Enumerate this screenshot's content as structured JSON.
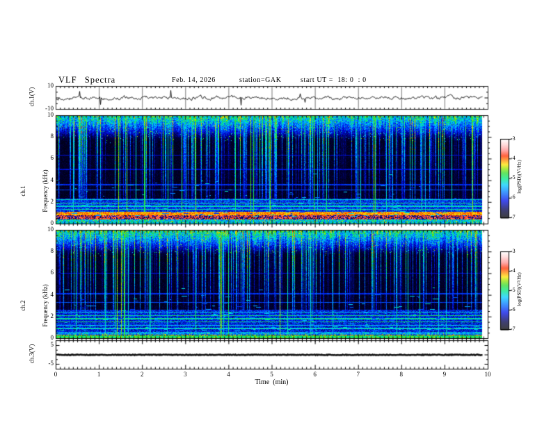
{
  "header": {
    "title": "VLF Spectra",
    "date": "Feb. 14, 2026",
    "station": "station=GAK",
    "start_ut": "start UT =  18: 0  : 0"
  },
  "axes": {
    "x": {
      "label": "Time  (min)",
      "min": 0,
      "max": 10,
      "tick_labels": [
        "0",
        "1",
        "2",
        "3",
        "4",
        "5",
        "6",
        "7",
        "8",
        "9",
        "10"
      ]
    }
  },
  "panels": {
    "ch1_wave": {
      "ylabel": "ch.1(V)",
      "yrange": [
        -10,
        10
      ],
      "tick_labels": [
        "10",
        "-10"
      ]
    },
    "spec1": {
      "ylabel_line1": "ch.1",
      "ylabel_line2": "Frequency (kHz)",
      "tick_labels": [
        "10",
        "8",
        "6",
        "4",
        "2",
        "0"
      ]
    },
    "spec2": {
      "ylabel_line1": "ch.2",
      "ylabel_line2": "Frequency (kHz)",
      "tick_labels": [
        "10",
        "8",
        "6",
        "4",
        "2",
        "0"
      ]
    },
    "ch3_wave": {
      "ylabel": "ch.3(V)",
      "yrange": [
        -5,
        5
      ],
      "tick_labels": [
        "5",
        "-5"
      ]
    }
  },
  "colorbar": {
    "label": "log(PSD)(V²/Hz)",
    "tick_labels": [
      "-3",
      "-4",
      "-5",
      "-6",
      "-7"
    ],
    "range": [
      -7,
      -3
    ]
  },
  "chart_data": {
    "type": "heatmap",
    "title": "VLF Spectra",
    "subtitle": "Feb. 14, 2026  station=GAK  start UT = 18:0:0",
    "x": {
      "label": "Time (min)",
      "range": [
        0,
        10
      ],
      "major_tick_min": 1,
      "minor_tick_min": 0.1
    },
    "panels": [
      {
        "id": "ch1-waveform",
        "type": "line",
        "ylabel": "ch.1(V)",
        "yrange": [
          -10,
          10
        ],
        "yticks": [
          10,
          -10
        ],
        "description": "broadband noise centered near 0 V, typical excursions ±2 V, impulsive spikes to about ±7 V"
      },
      {
        "id": "ch1-spectrogram",
        "type": "heatmap",
        "ylabel": "ch.1 Frequency (kHz)",
        "yrange": [
          0,
          10
        ],
        "yticks": [
          0,
          2,
          4,
          6,
          8,
          10
        ],
        "z_label": "log(PSD)(V²/Hz)",
        "z_range": [
          -7,
          -3
        ],
        "features": {
          "sferic_streak_density": 0.5,
          "line_emissions": [
            {
              "f": 1.05,
              "psd": -5.3
            },
            {
              "f": 1.3,
              "psd": -5.1
            },
            {
              "f": 1.6,
              "psd": -5.2
            },
            {
              "f": 1.9,
              "psd": -5.0
            },
            {
              "f": 2.2,
              "psd": -5.2
            },
            {
              "f": 3.1,
              "psd": -5.9
            },
            {
              "f": 3.6,
              "psd": -6.0
            },
            {
              "f": 5.0,
              "psd": -6.2
            },
            {
              "f": 6.3,
              "psd": -6.2
            }
          ],
          "bands": [
            {
              "f_khz": [
                1.1,
                2.3
              ],
              "psd": [
                -6.4,
                -5.6
              ]
            },
            {
              "f_khz": [
                0.75,
                1.1
              ],
              "psd": [
                -4.4,
                -3.8
              ]
            },
            {
              "f_khz": [
                0.4,
                0.75
              ],
              "psd": [
                -3.95,
                -3.55
              ],
              "speckle_dark": true
            },
            {
              "f_khz": [
                0.0,
                0.4
              ],
              "psd": [
                -5.8,
                -4.8
              ]
            }
          ]
        }
      },
      {
        "id": "ch2-spectrogram",
        "type": "heatmap",
        "ylabel": "ch.2 Frequency (kHz)",
        "yrange": [
          0,
          10
        ],
        "yticks": [
          0,
          2,
          4,
          6,
          8,
          10
        ],
        "z_label": "log(PSD)(V²/Hz)",
        "z_range": [
          -7,
          -3
        ],
        "features": {
          "sferic_streak_density": 0.48,
          "line_emissions": [
            {
              "f": 0.9,
              "psd": -5.2
            },
            {
              "f": 1.2,
              "psd": -5.3
            },
            {
              "f": 1.5,
              "psd": -5.0
            },
            {
              "f": 1.8,
              "psd": -5.1
            },
            {
              "f": 2.1,
              "psd": -5.0
            },
            {
              "f": 2.4,
              "psd": -5.3
            },
            {
              "f": 3.3,
              "psd": -5.9
            },
            {
              "f": 4.1,
              "psd": -6.0
            },
            {
              "f": 6.0,
              "psd": -6.2
            }
          ],
          "bands": [
            {
              "f_khz": [
                0.6,
                2.6
              ],
              "psd": [
                -6.5,
                -5.7
              ]
            },
            {
              "f_khz": [
                0.35,
                0.6
              ],
              "psd": [
                -6.0,
                -5.0
              ]
            },
            {
              "f_khz": [
                0.28,
                0.35
              ],
              "psd": [
                -4.0,
                -3.7
              ],
              "speckle_dark": true
            },
            {
              "f_khz": [
                0.0,
                0.28
              ],
              "psd": [
                -5.2,
                -4.5
              ]
            }
          ]
        }
      },
      {
        "id": "ch3-waveform",
        "type": "line",
        "ylabel": "ch.3(V)",
        "yrange": [
          -7.5,
          7.5
        ],
        "yticks": [
          5,
          -5
        ],
        "description": "flat heavy trace at 0 V for whole interval"
      }
    ],
    "colorbars": [
      {
        "label": "log(PSD)(V²/Hz)",
        "ticks": [
          -3,
          -4,
          -5,
          -6,
          -7
        ],
        "panel": "ch1-spectrogram"
      },
      {
        "label": "log(PSD)(V²/Hz)",
        "ticks": [
          -3,
          -4,
          -5,
          -6,
          -7
        ],
        "panel": "ch2-spectrogram"
      }
    ],
    "colormap_stops": [
      [
        0,
        "#000000"
      ],
      [
        0.1,
        "#000046"
      ],
      [
        0.22,
        "#0010e8"
      ],
      [
        0.33,
        "#0078ff"
      ],
      [
        0.42,
        "#00ccff"
      ],
      [
        0.5,
        "#00e882"
      ],
      [
        0.57,
        "#30dc30"
      ],
      [
        0.63,
        "#96e400"
      ],
      [
        0.68,
        "#ffe400"
      ],
      [
        0.73,
        "#ff9000"
      ],
      [
        0.79,
        "#ff3000"
      ],
      [
        0.86,
        "#ff8c8c"
      ],
      [
        0.94,
        "#ffd6d6"
      ],
      [
        1,
        "#ffffff"
      ]
    ],
    "legend_position": "right-side vertical colorbars, one per spectrogram"
  }
}
